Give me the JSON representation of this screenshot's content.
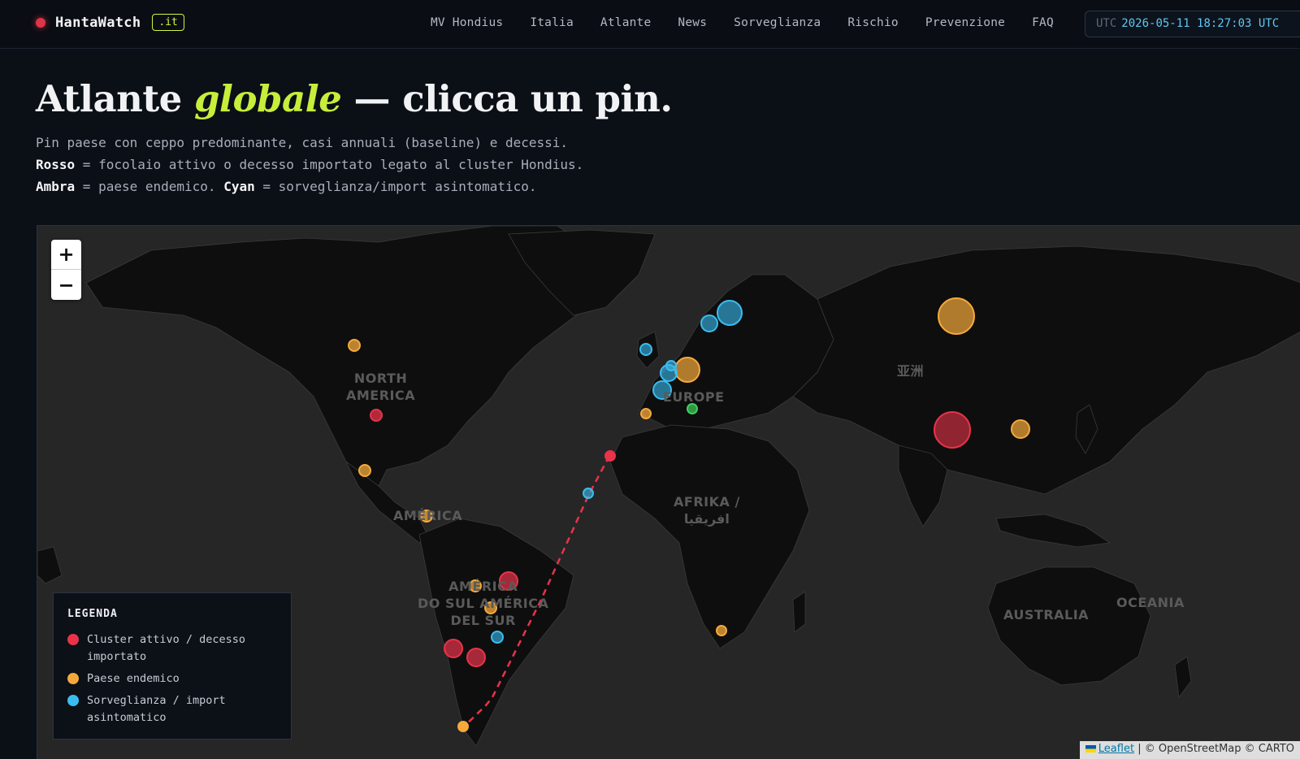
{
  "header": {
    "brand": "HantaWatch",
    "tld": ".it",
    "nav": [
      "MV Hondius",
      "Italia",
      "Atlante",
      "News",
      "Sorveglianza",
      "Rischio",
      "Prevenzione",
      "FAQ"
    ],
    "clock_label": "UTC",
    "clock_time": "2026-05-11 18:27:03 UTC"
  },
  "hero": {
    "title_pre": "Atlante ",
    "title_accent": "globale",
    "title_post": " — clicca un pin.",
    "line1": "Pin paese con ceppo predominante, casi annuali (baseline) e decessi.",
    "line2_bold": "Rosso",
    "line2_rest": " = focolaio attivo o decesso importato legato al cluster Hondius.",
    "line3_bold1": "Ambra",
    "line3_mid": " = paese endemico. ",
    "line3_bold2": "Cyan",
    "line3_rest": " = sorveglianza/import asintomatico."
  },
  "map": {
    "zoom_in": "+",
    "zoom_out": "−",
    "regions": {
      "north_america": "NORTH\nAMERICA",
      "europe": "EUROPE",
      "asia": "亚洲",
      "africa": "AFRIKA /\nافريقيا",
      "america": "AMÉRICA",
      "south_america": "AMÉRICA\nDO SUL AMÉRICA\nDEL SUR",
      "australia": "AUSTRALIA",
      "oceania": "OCEANIA"
    },
    "colors": {
      "active": "#e8334a",
      "endemic": "#f5a93b",
      "surveillance": "#3bbcf0",
      "other": "#3fd15c"
    },
    "legend": {
      "title": "LEGENDA",
      "items": [
        {
          "label": "Cluster attivo / decesso importato",
          "color": "#e8334a"
        },
        {
          "label": "Paese endemico",
          "color": "#f5a93b"
        },
        {
          "label": "Sorveglianza / import asintomatico",
          "color": "#3bbcf0"
        }
      ]
    },
    "attribution": {
      "leaflet": "Leaflet",
      "rest": " | © OpenStreetMap © CARTO"
    }
  }
}
